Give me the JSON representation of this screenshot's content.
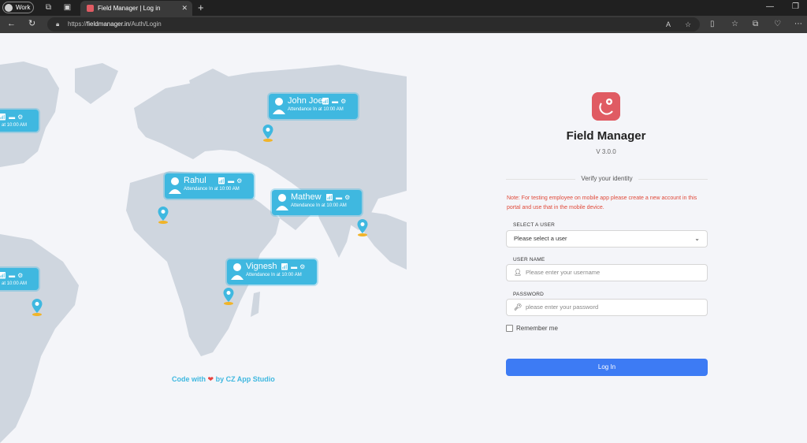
{
  "browser": {
    "profile_label": "Work",
    "tab_title": "Field Manager | Log in",
    "url_prefix": "https://",
    "url_host": "fieldmanager.in",
    "url_path": "/Auth/Login"
  },
  "map": {
    "cards": [
      {
        "name": "",
        "subtitle": "at 10:00 AM"
      },
      {
        "name": "John Joe",
        "subtitle": "Attendance In at 10:00 AM"
      },
      {
        "name": "Rahul",
        "subtitle": "Attendance In at 10:00 AM"
      },
      {
        "name": "Mathew",
        "subtitle": "Attendance In at 10:00 AM"
      },
      {
        "name": "",
        "subtitle": "at 10:00 AM"
      },
      {
        "name": "Vignesh",
        "subtitle": "Attendance In at 10:00 AM"
      }
    ],
    "credit_prefix": "Code with",
    "credit_suffix": "by CZ App Studio"
  },
  "login": {
    "app_name": "Field Manager",
    "version": "V 3.0.0",
    "verify_heading": "Verify your identity",
    "note": "Note: For testing employee on mobile app please create a new account in this portal and use that in the mobile device.",
    "select_user_label": "SELECT A USER",
    "select_user_value": "Please select a user",
    "username_label": "USER NAME",
    "username_placeholder": "Please enter your username",
    "password_label": "PASSWORD",
    "password_placeholder": "please enter your password",
    "remember_label": "Remember me",
    "login_button": "Log In"
  },
  "colors": {
    "accent": "#3d7bf4",
    "card": "#3fb8e0",
    "note": "#e04a3a",
    "logo": "#e05b63"
  }
}
